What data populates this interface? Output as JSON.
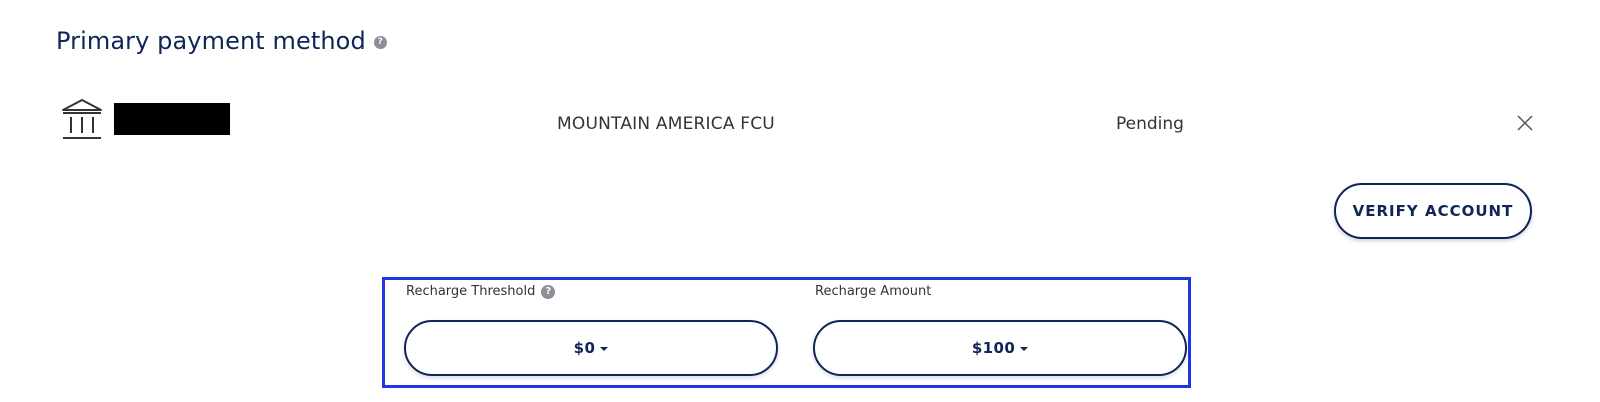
{
  "section": {
    "title": "Primary payment method",
    "help_icon": "question-circle-icon"
  },
  "payment_method": {
    "icon": "bank-icon",
    "bank_name": "MOUNTAIN AMERICA FCU",
    "status": "Pending",
    "close_icon": "close-icon"
  },
  "actions": {
    "verify_label": "VERIFY ACCOUNT"
  },
  "recharge": {
    "threshold": {
      "label": "Recharge Threshold",
      "help_icon": "question-circle-icon",
      "value": "$0"
    },
    "amount": {
      "label": "Recharge Amount",
      "value": "$100"
    }
  },
  "colors": {
    "navy": "#0f2557",
    "highlight_border": "#1d35e6",
    "help_icon_gray": "#8a8f98"
  }
}
